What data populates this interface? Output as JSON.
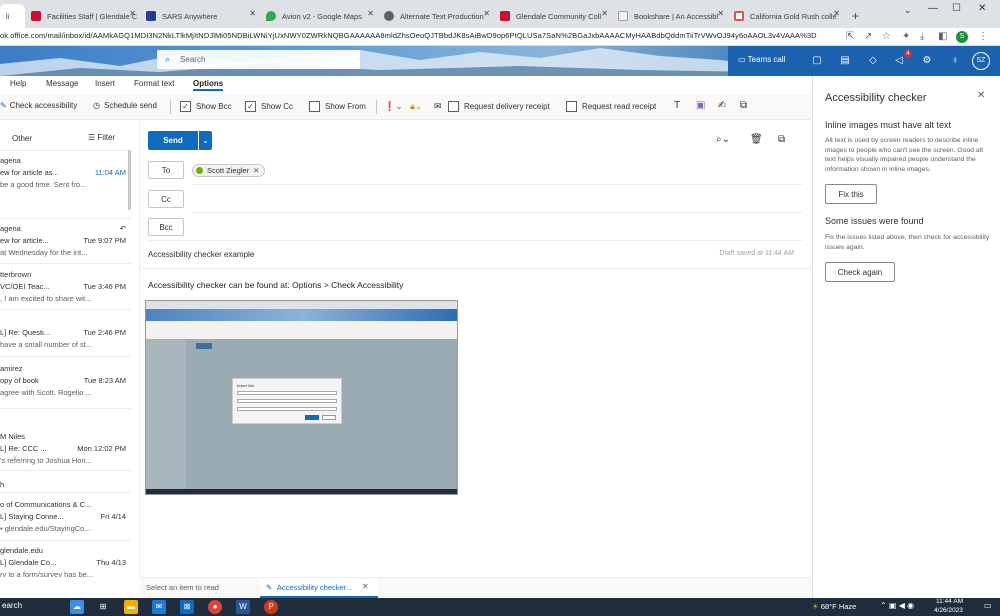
{
  "browser": {
    "tabs": [
      {
        "label": "li",
        "active": true
      },
      {
        "label": "Facilities Staff | Glendale C"
      },
      {
        "label": "SARS Anywhere"
      },
      {
        "label": "Avion v2 - Google Maps"
      },
      {
        "label": "Alternate Text Production"
      },
      {
        "label": "Glendale Community Coll"
      },
      {
        "label": "Bookshare | An Accessibl"
      },
      {
        "label": "California Gold Rush colle"
      }
    ],
    "new_tab": "+",
    "url": "ok.office.com/mail/inbox/id/AAMkAGQ1MDI3N2NkLTlkMjItNDJlMi05NDBiLWNiYjUxNWY0ZWRkNQBGAAAAAA8mldZhsOeoQJTBbdJK8sAiBwD9op6PtQLUSa7SaN%2BGaJxbAAAACMyHAABdbQddmTiiTrVWvOJ94y6oAAOL3v4VAAA%3D",
    "profile_badge": "S"
  },
  "owa": {
    "search_placeholder": "Search",
    "teams_call": "Teams call",
    "avatar": "SZ",
    "badge_count": "4"
  },
  "ribbon": {
    "tabs": [
      "Help",
      "Message",
      "Insert",
      "Format text",
      "Options"
    ],
    "buttons": {
      "check_accessibility": "Check accessibility",
      "schedule_send": "Schedule send",
      "show_bcc": "Show Bcc",
      "show_cc": "Show Cc",
      "show_from": "Show From",
      "request_delivery": "Request delivery receipt",
      "request_read": "Request read receipt"
    }
  },
  "message_list": {
    "header_other": "Other",
    "filter": "Filter",
    "items": [
      {
        "sender": "agena",
        "subject": "ew for article as...",
        "time": "11:04 AM",
        "preview": "be a good time. Sent fro..."
      },
      {
        "sender": "agena",
        "subject": "ew for article...",
        "time": "Tue 9:07 PM",
        "preview": "at Wednesday for the int..."
      },
      {
        "sender": "tterbrown",
        "subject": "VC/OEI Teac...",
        "time": "Tue 3:46 PM",
        "preview": ", I am excited to share wit..."
      },
      {
        "sender": "",
        "subject": "L] Re: Questi...",
        "time": "Tue 2:46 PM",
        "preview": "have a small number of st..."
      },
      {
        "sender": "amirez",
        "subject": "opy of book",
        "time": "Tue 8:23 AM",
        "preview": "agree with Scott. Rogelio ..."
      },
      {
        "sender": "M Niles",
        "subject": "L] Re: CCC ...",
        "time": "Mon 12:02 PM",
        "preview": "'s referring to Joshua Hori..."
      },
      {
        "sender": "o of Communications & C...",
        "subject": "L] Staying Conne...",
        "time": "Fri 4/14",
        "preview": "• glendale.edu/StayingCo..."
      },
      {
        "sender": "glendale.edu",
        "subject": "L] Glendale Co...",
        "time": "Thu 4/13",
        "preview": "ry to a form/survey has be..."
      }
    ],
    "group_label": "h"
  },
  "compose": {
    "send": "Send",
    "to": "To",
    "cc": "Cc",
    "bcc": "Bcc",
    "recipient": "Scott Ziegler",
    "subject": "Accessibility checker example",
    "draft_saved": "Draft saved at 11:44 AM",
    "body": "Accessibility checker can be found at:  Options > Check Accessibility",
    "inline_dialog_title": "Insert link"
  },
  "bottom": {
    "search_stub": "earch",
    "select_item": "Select an item to read",
    "draft_tab": "Accessibility checker..."
  },
  "panel": {
    "title": "Accessibility checker",
    "section1_title": "Inline images must have alt text",
    "section1_desc": "Alt text is used by screen readers to describe inline images to people who can't see the screen. Good alt text helps visually impaired people understand the information shown in inline images.",
    "fix_this": "Fix this",
    "section2_title": "Some issues were found",
    "section2_desc": "Fix the issues listed above, then check for accessibility issues again.",
    "check_again": "Check again"
  },
  "taskbar": {
    "weather": "68°F  Haze",
    "time": "11:44 AM",
    "date": "4/26/2023"
  },
  "colors": {
    "accent": "#0f6cbd",
    "taskbar": "#1f2d3d",
    "tabbar": "#dee1e6"
  }
}
